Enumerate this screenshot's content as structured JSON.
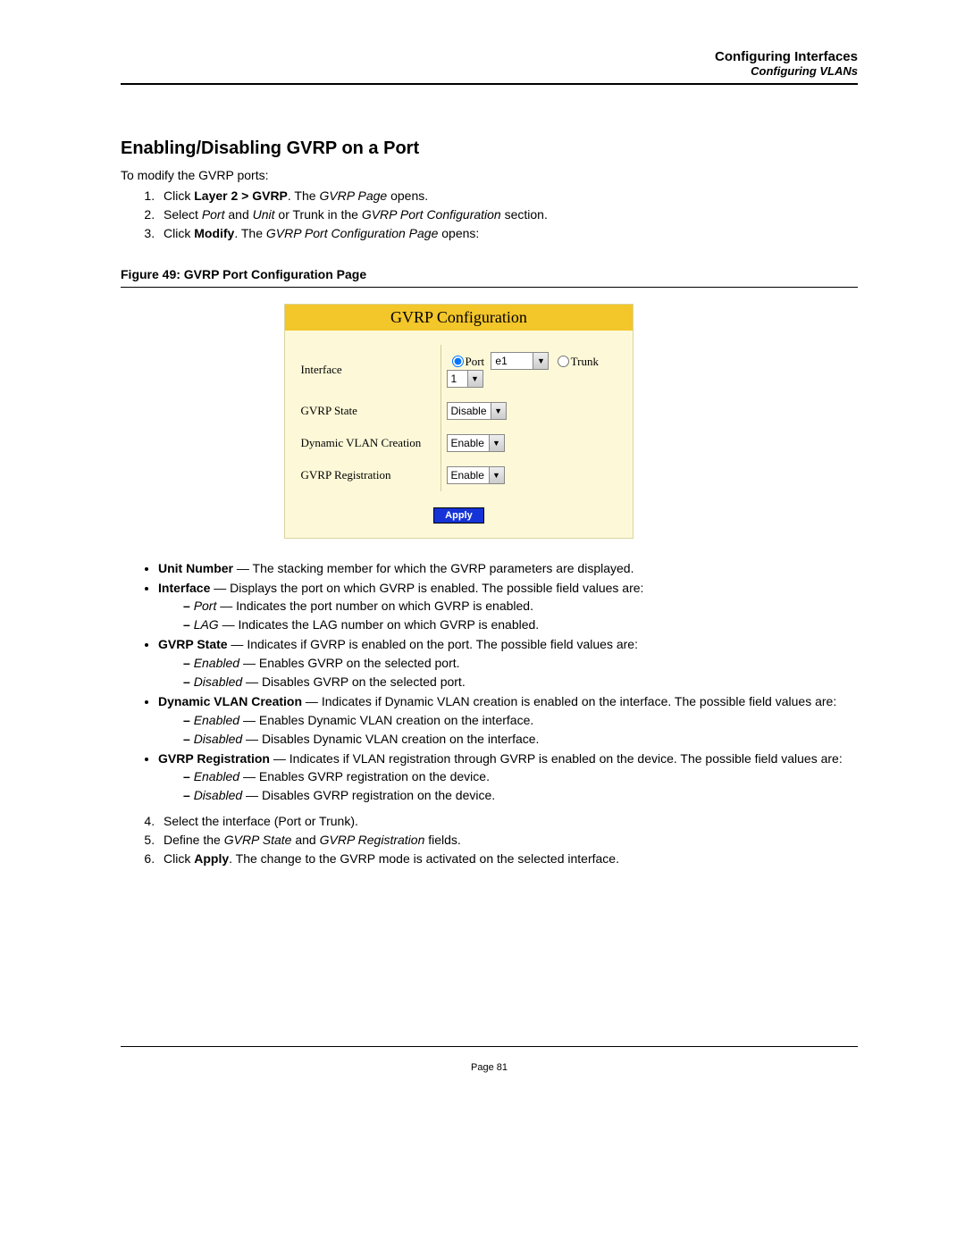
{
  "header": {
    "line1": "Configuring Interfaces",
    "line2": "Configuring VLANs"
  },
  "section_title": "Enabling/Disabling GVRP on a Port",
  "intro": "To modify the GVRP ports:",
  "steps_top": [
    {
      "pre": "Click ",
      "bold": "Layer 2 > GVRP",
      "mid": ". The ",
      "em": "GVRP Page",
      "post": " opens."
    },
    {
      "pre": "Select ",
      "em1": "Port",
      "mid1": " and ",
      "em2": "Unit",
      "mid2": " or Trunk in the ",
      "em3": "GVRP Port Configuration",
      "post": " section."
    },
    {
      "pre": "Click ",
      "bold": "Modify",
      "mid": ". The ",
      "em": "GVRP Port Configuration Page",
      "post": " opens:"
    }
  ],
  "figure_caption": "Figure 49:  GVRP Port Configuration Page",
  "panel": {
    "title": "GVRP Configuration",
    "rows": {
      "interface_label": "Interface",
      "port_label": "Port",
      "port_value": "e1",
      "trunk_label": "Trunk",
      "trunk_value": "1",
      "gvrp_state_label": "GVRP State",
      "gvrp_state_value": "Disable",
      "dyn_vlan_label": "Dynamic VLAN Creation",
      "dyn_vlan_value": "Enable",
      "gvrp_reg_label": "GVRP Registration",
      "gvrp_reg_value": "Enable"
    },
    "apply_label": "Apply"
  },
  "defs": {
    "unit_number": {
      "term": "Unit Number",
      "desc": " — The stacking member for which the GVRP parameters are displayed."
    },
    "interface": {
      "term": "Interface",
      "desc": " — Displays the port on which GVRP is enabled. The possible field values are:",
      "sub": [
        {
          "em": "Port",
          "desc": " — Indicates the port number on which GVRP is enabled."
        },
        {
          "em": "LAG",
          "desc": " — Indicates the LAG number on which GVRP is enabled."
        }
      ]
    },
    "gvrp_state": {
      "term": "GVRP State",
      "desc": " — Indicates if GVRP is enabled on the port. The possible field values are:",
      "sub": [
        {
          "em": "Enabled",
          "desc": " — Enables GVRP on the selected port."
        },
        {
          "em": "Disabled",
          "desc": " — Disables GVRP on the selected port."
        }
      ]
    },
    "dyn_vlan": {
      "term": "Dynamic VLAN Creation",
      "desc": " — Indicates if Dynamic VLAN creation is enabled on the interface. The possible field values are:",
      "sub": [
        {
          "em": "Enabled",
          "desc": " — Enables Dynamic VLAN creation on the interface."
        },
        {
          "em": "Disabled",
          "desc": " — Disables Dynamic VLAN creation on the interface."
        }
      ]
    },
    "gvrp_reg": {
      "term": "GVRP Registration",
      "desc": " — Indicates if VLAN registration through GVRP is enabled on the device. The possible field values are:",
      "sub": [
        {
          "em": "Enabled",
          "desc": " — Enables GVRP registration on the device."
        },
        {
          "em": "Disabled",
          "desc": " — Disables GVRP registration on the device."
        }
      ]
    }
  },
  "steps_bottom": [
    {
      "text": "Select the interface (Port or Trunk)."
    },
    {
      "pre": "Define the ",
      "em1": "GVRP State",
      "mid": " and ",
      "em2": "GVRP Registration",
      "post": " fields."
    },
    {
      "pre": "Click ",
      "bold": "Apply",
      "post": ". The change to the GVRP mode is activated on the selected interface."
    }
  ],
  "footer": "Page 81"
}
